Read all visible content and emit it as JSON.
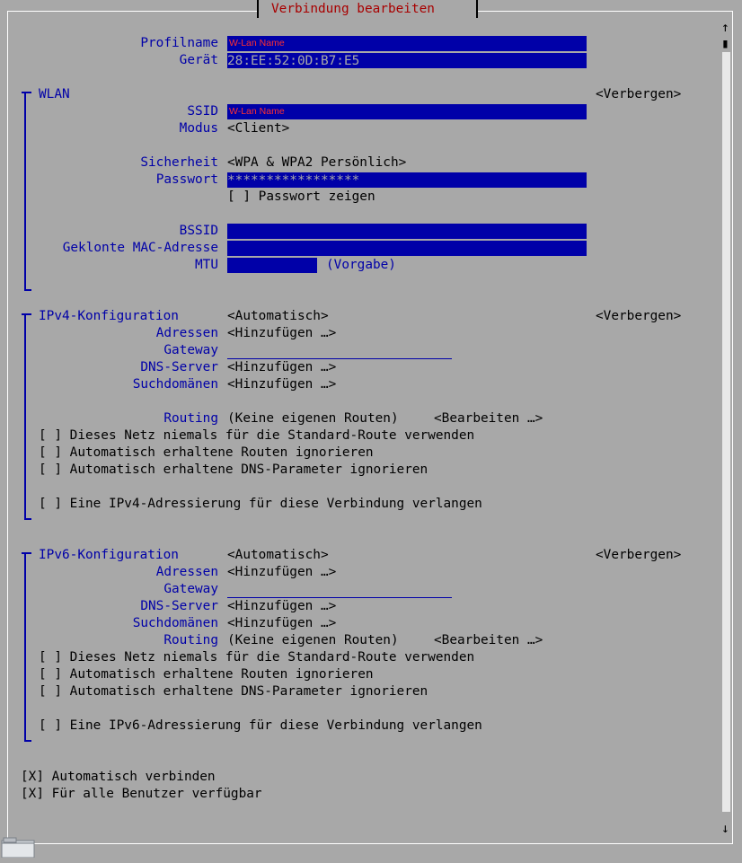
{
  "window": {
    "title": "Verbindung bearbeiten"
  },
  "profile": {
    "name_label": "Profilname",
    "name_value": "W-Lan Name",
    "device_label": "Gerät",
    "device_value": "28:EE:52:0D:B7:E5"
  },
  "wlan": {
    "header": "WLAN",
    "toggle": "<Verbergen>",
    "ssid_label": "SSID",
    "ssid_value": "W-Lan Name",
    "mode_label": "Modus",
    "mode_value": "<Client>",
    "security_label": "Sicherheit",
    "security_value": "<WPA & WPA2 Persönlich>",
    "password_label": "Passwort",
    "password_value": "*****************",
    "show_password": "[ ] Passwort zeigen",
    "bssid_label": "BSSID",
    "clone_mac_label": "Geklonte MAC-Adresse",
    "mtu_label": "MTU",
    "mtu_default": "(Vorgabe)"
  },
  "ipv4": {
    "header": "IPv4-Konfiguration",
    "mode": "<Automatisch>",
    "toggle": "<Verbergen>",
    "addresses_label": "Adressen",
    "addresses_value": "<Hinzufügen …>",
    "gateway_label": "Gateway",
    "dns_label": "DNS-Server",
    "dns_value": "<Hinzufügen …>",
    "search_label": "Suchdomänen",
    "search_value": "<Hinzufügen …>",
    "routing_label": "Routing",
    "routing_value": "(Keine eigenen Routen)",
    "routing_edit": "<Bearbeiten …>",
    "never_default": "[ ] Dieses Netz niemals für die Standard-Route verwenden",
    "ignore_routes": "[ ] Automatisch erhaltene Routen ignorieren",
    "ignore_dns": "[ ] Automatisch erhaltene DNS-Parameter ignorieren",
    "require": "[ ] Eine IPv4-Adressierung für diese Verbindung verlangen"
  },
  "ipv6": {
    "header": "IPv6-Konfiguration",
    "mode": "<Automatisch>",
    "toggle": "<Verbergen>",
    "addresses_label": "Adressen",
    "addresses_value": "<Hinzufügen …>",
    "gateway_label": "Gateway",
    "dns_label": "DNS-Server",
    "dns_value": "<Hinzufügen …>",
    "search_label": "Suchdomänen",
    "search_value": "<Hinzufügen …>",
    "routing_label": "Routing",
    "routing_value": "(Keine eigenen Routen)",
    "routing_edit": "<Bearbeiten …>",
    "never_default": "[ ] Dieses Netz niemals für die Standard-Route verwenden",
    "ignore_routes": "[ ] Automatisch erhaltene Routen ignorieren",
    "ignore_dns": "[ ] Automatisch erhaltene DNS-Parameter ignorieren",
    "require": "[ ] Eine IPv6-Adressierung für diese Verbindung verlangen"
  },
  "general": {
    "autoconnect": "[X] Automatisch verbinden",
    "all_users": "[X] Für alle Benutzer verfügbar"
  },
  "scrollbar": {
    "up": "↑",
    "down": "↓",
    "thumb": "▮"
  },
  "colors": {
    "background": "#a8a8a8",
    "accent": "#0000a8",
    "frame": "#ffffff"
  }
}
